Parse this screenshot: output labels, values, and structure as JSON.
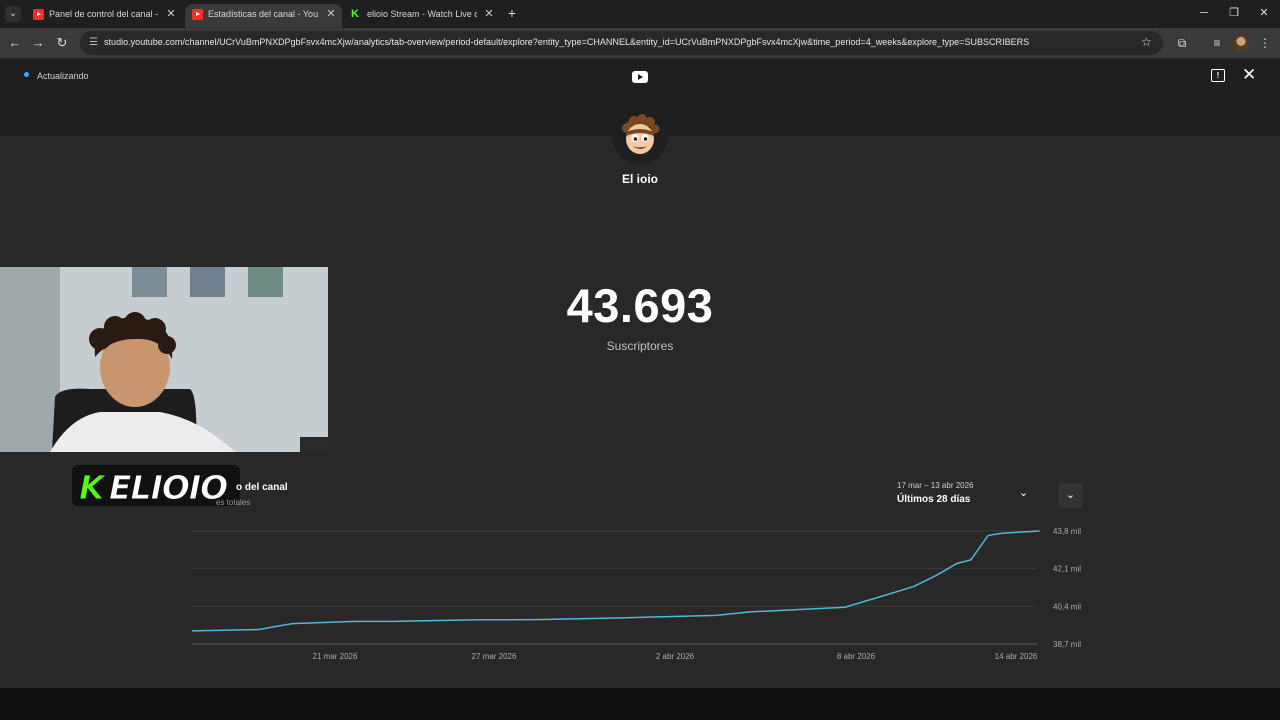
{
  "browser": {
    "tabs": [
      {
        "title": "Panel de control del canal - YouTube Studio",
        "favicon": "youtube-icon",
        "active": false
      },
      {
        "title": "Estadísticas del canal - YouTube Studio",
        "favicon": "youtube-icon",
        "active": true
      },
      {
        "title": "elioio Stream - Watch Live on Kick",
        "favicon": "kick-icon",
        "active": false
      }
    ],
    "url": "studio.youtube.com/channel/UCrVuBmPNXDPgbFsvx4mcXjw/analytics/tab-overview/period-default/explore?entity_type=CHANNEL&entity_id=UCrVuBmPNXDPgbFsvx4mcXjw&time_period=4_weeks&explore_type=SUBSCRIBERS"
  },
  "header": {
    "status": "Actualizando"
  },
  "channel": {
    "name": "El ioio",
    "subscriber_count": "43.693",
    "subscriber_label": "Suscriptores"
  },
  "overlay": {
    "kick_logo_text": "KELIOIO"
  },
  "card": {
    "title": "o del canal",
    "subtitle": "es totales",
    "date_range": "17 mar – 13 abr 2026",
    "period": "Últimos 28 días"
  },
  "chart_data": {
    "type": "line",
    "x_tick_labels": [
      "21 mar 2026",
      "27 mar 2026",
      "2 abr 2026",
      "8 abr 2026",
      "14 abr 2026"
    ],
    "y_tick_labels": [
      "43,8 mil",
      "42,1 mil",
      "40,4 mil",
      "38,7 mil"
    ],
    "ylim": [
      38700,
      43800
    ],
    "xlim": [
      0,
      28
    ],
    "series": [
      {
        "color": "#4fb8d6",
        "points": [
          [
            0,
            39290
          ],
          [
            2.3,
            39350
          ],
          [
            3.5,
            39620
          ],
          [
            5.7,
            39720
          ],
          [
            7,
            39720
          ],
          [
            10,
            39790
          ],
          [
            12,
            39800
          ],
          [
            15,
            39880
          ],
          [
            18.3,
            39990
          ],
          [
            19.5,
            40150
          ],
          [
            22.8,
            40360
          ],
          [
            24,
            40820
          ],
          [
            25.2,
            41290
          ],
          [
            26,
            41800
          ],
          [
            26.7,
            42330
          ],
          [
            27.2,
            42500
          ],
          [
            27.8,
            43600
          ],
          [
            28.3,
            43700
          ],
          [
            29.6,
            43800
          ]
        ]
      }
    ]
  },
  "colors": {
    "accent": "#3ea6ff",
    "line": "#4fb8d6",
    "kick_green": "#53fc18"
  }
}
